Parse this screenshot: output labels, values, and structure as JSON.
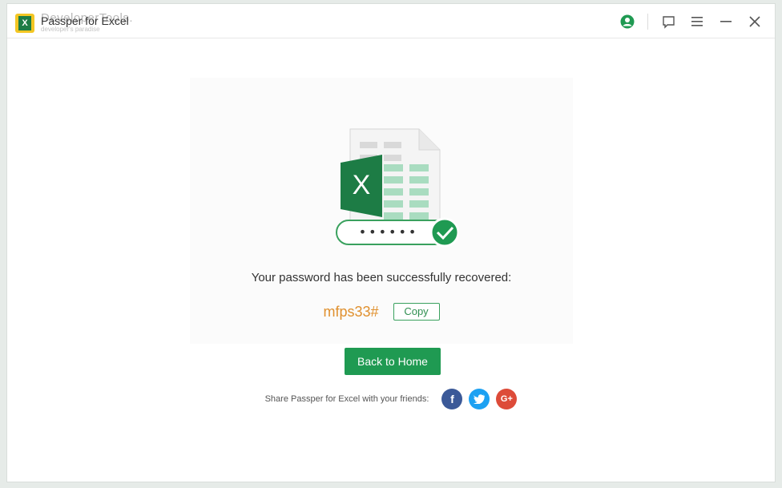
{
  "titlebar": {
    "app_title": "Passper for Excel",
    "watermark": "DeveloperTools.",
    "watermark_sub": "developer's paradise",
    "logo_letter": "X",
    "icons": [
      "account-icon",
      "feedback-icon",
      "menu-icon",
      "minimize-icon",
      "close-icon"
    ]
  },
  "hero": {
    "excel_letter": "X",
    "masked_password": "••••••"
  },
  "result": {
    "message": "Your password has been successfully recovered:",
    "password": "mfps33#",
    "copy_label": "Copy"
  },
  "actions": {
    "back_label": "Back to Home"
  },
  "share": {
    "label": "Share Passper for Excel with your friends:",
    "networks": [
      {
        "name": "facebook",
        "glyph": "f",
        "color": "#3b5998"
      },
      {
        "name": "twitter",
        "glyph": "t",
        "color": "#1da1f2"
      },
      {
        "name": "google-plus",
        "glyph": "G+",
        "color": "#dd4b39"
      }
    ]
  },
  "colors": {
    "brand_green": "#1f9a52",
    "password_orange": "#e0902e",
    "excel_green": "#1d7c45"
  }
}
